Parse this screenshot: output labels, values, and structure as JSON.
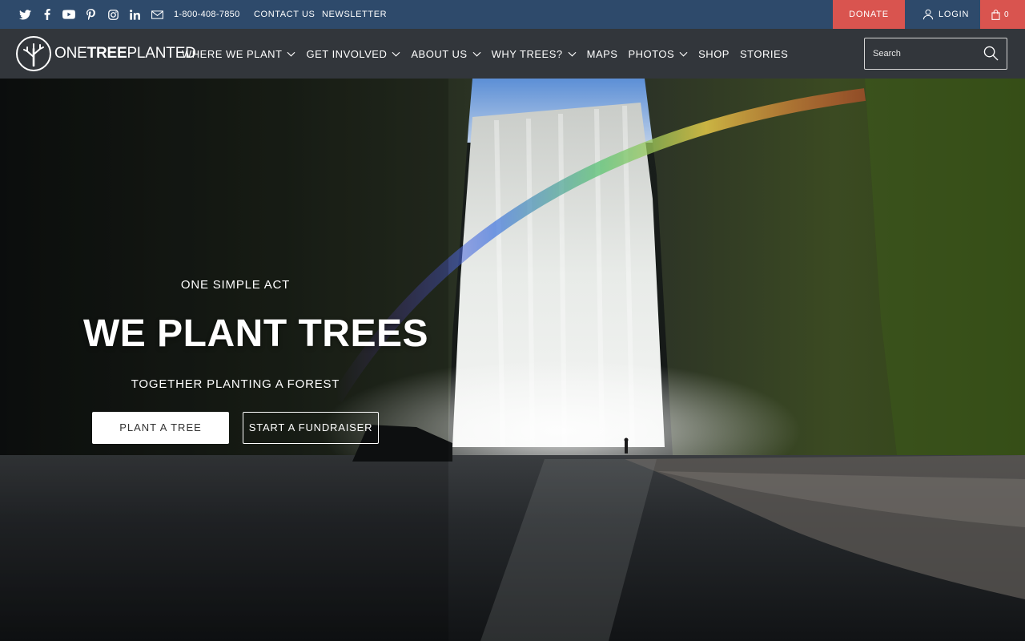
{
  "topbar": {
    "social_icons": [
      "twitter-icon",
      "facebook-icon",
      "youtube-icon",
      "pinterest-icon",
      "instagram-icon",
      "linkedin-icon",
      "email-icon"
    ],
    "phone": "1-800-408-7850",
    "contact_label": "CONTACT US",
    "newsletter_label": "NEWSLETTER",
    "donate_label": "DONATE",
    "login_label": "LOGIN",
    "cart_count": "0",
    "colors": {
      "bar": "#2e4a6b",
      "accent": "#d9544f"
    }
  },
  "navbar": {
    "logo": {
      "part1": "ONE",
      "part2": "TREE",
      "part3": "PLANTED"
    },
    "items": [
      {
        "label": "WHERE WE PLANT",
        "has_dropdown": true
      },
      {
        "label": "GET INVOLVED",
        "has_dropdown": true
      },
      {
        "label": "ABOUT US",
        "has_dropdown": true
      },
      {
        "label": "WHY TREES?",
        "has_dropdown": true
      },
      {
        "label": "MAPS",
        "has_dropdown": false
      },
      {
        "label": "PHOTOS",
        "has_dropdown": true
      },
      {
        "label": "SHOP",
        "has_dropdown": false
      },
      {
        "label": "STORIES",
        "has_dropdown": false
      }
    ],
    "search": {
      "placeholder": "Search",
      "value": ""
    },
    "colors": {
      "bar": "#32363b"
    }
  },
  "hero": {
    "kicker": "ONE SIMPLE ACT",
    "title": "WE PLANT TREES",
    "subtitle": "TOGETHER PLANTING A FOREST",
    "primary_button": "PLANT A TREE",
    "secondary_button": "START A FUNDRAISER"
  }
}
